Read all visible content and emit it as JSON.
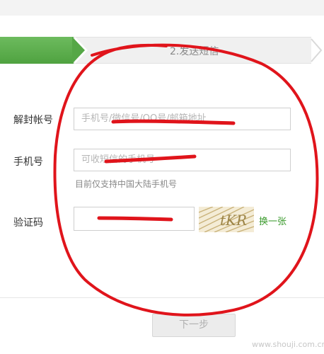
{
  "steps": {
    "step2_label": "2.发送短信"
  },
  "form": {
    "account": {
      "label": "解封帐号",
      "placeholder": "手机号/微信号/QQ号/邮箱地址"
    },
    "phone": {
      "label": "手机号",
      "placeholder": "可收短信的手机号",
      "hint": "目前仅支持中国大陆手机号"
    },
    "captcha": {
      "label": "验证码",
      "value": "",
      "image_text": "tKR",
      "refresh_label": "换一张"
    }
  },
  "footer": {
    "next_label": "下一步"
  },
  "watermark": "www.shouji.com.cn",
  "colors": {
    "accent_green": "#4fa240",
    "link_green": "#3a9a2c",
    "annotation_red": "#e0141b"
  }
}
